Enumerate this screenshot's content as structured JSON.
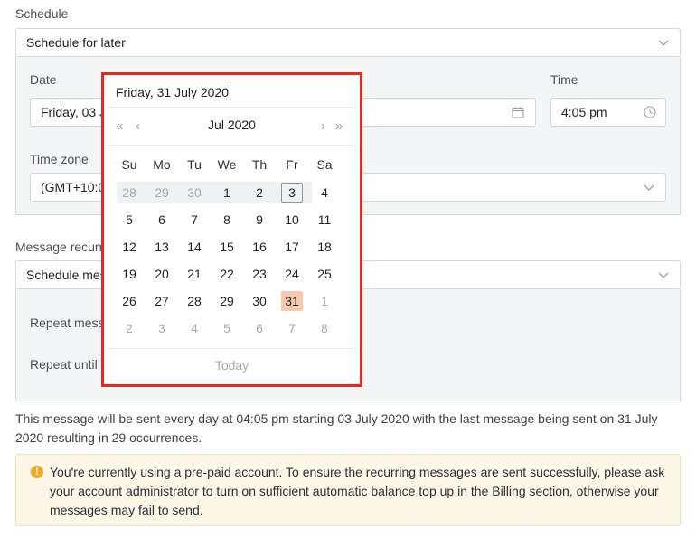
{
  "schedule": {
    "label": "Schedule",
    "select_value": "Schedule for later",
    "date_label": "Date",
    "date_value": "Friday, 03 J",
    "time_label": "Time",
    "time_value": "4:05 pm",
    "timezone_label": "Time zone",
    "timezone_value": "(GMT+10:0"
  },
  "recurrence": {
    "label": "Message recurr",
    "select_value": "Schedule mes",
    "repeat_label": "Repeat messa",
    "repeat_until_label": "Repeat until"
  },
  "summary_text": "This message will be sent every day at 04:05 pm starting 03 July 2020 with the last message being sent on 31 July 2020 resulting in 29 occurrences.",
  "alert": {
    "icon": "!",
    "text": "You're currently using a pre-paid account. To ensure the recurring messages are sent successfully, please ask your account administrator to turn on sufficient automatic balance top up in the Billing section, otherwise your messages may fail to send."
  },
  "calendar": {
    "input_value": "Friday, 31 July 2020",
    "month_title": "Jul 2020",
    "nav": {
      "prev_year": "«",
      "prev_month": "‹",
      "next_month": "›",
      "next_year": "»"
    },
    "weekdays": [
      "Su",
      "Mo",
      "Tu",
      "We",
      "Th",
      "Fr",
      "Sa"
    ],
    "weeks": [
      [
        "28",
        "29",
        "30",
        "1",
        "2",
        "3",
        "4"
      ],
      [
        "5",
        "6",
        "7",
        "8",
        "9",
        "10",
        "11"
      ],
      [
        "12",
        "13",
        "14",
        "15",
        "16",
        "17",
        "18"
      ],
      [
        "19",
        "20",
        "21",
        "22",
        "23",
        "24",
        "25"
      ],
      [
        "26",
        "27",
        "28",
        "29",
        "30",
        "31",
        "1"
      ],
      [
        "2",
        "3",
        "4",
        "5",
        "6",
        "7",
        "8"
      ]
    ],
    "today_label": "Today",
    "highlight_color": "#f9c9ad",
    "border_color": "#e8281d"
  }
}
